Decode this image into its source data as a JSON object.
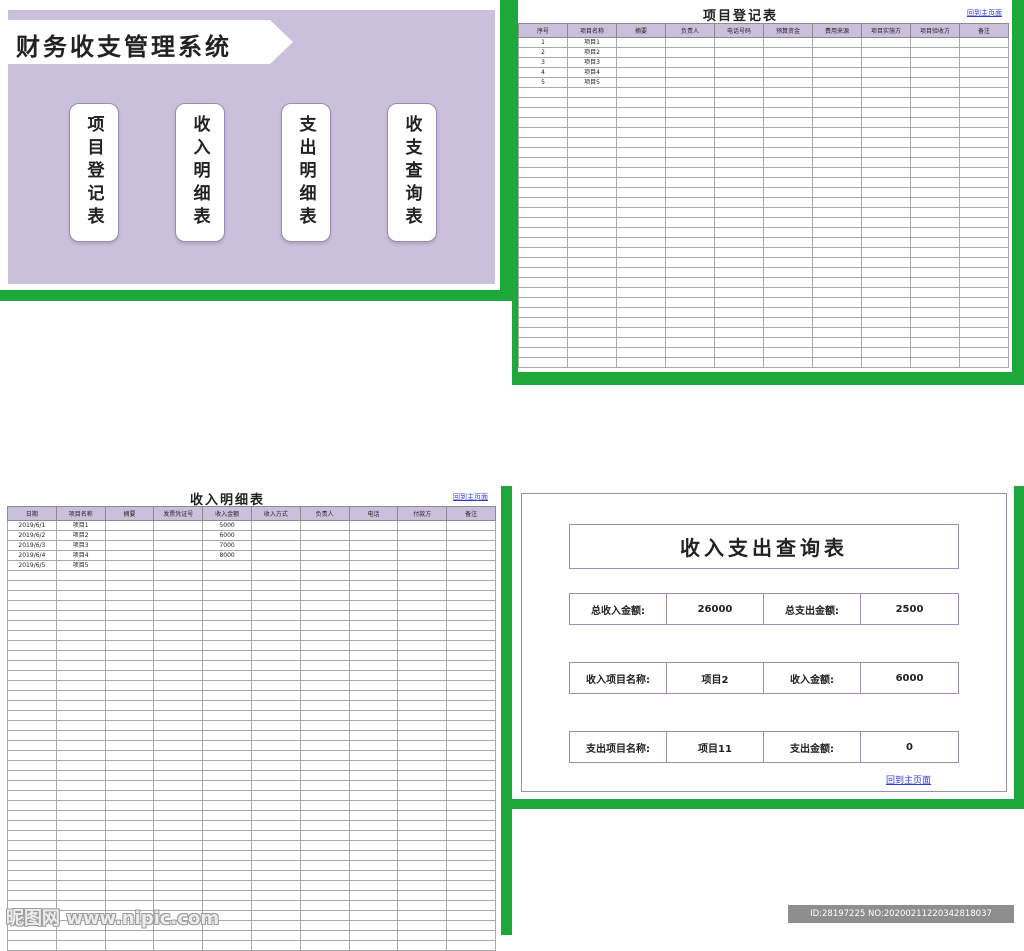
{
  "menu": {
    "title": "财务收支管理系统",
    "buttons": [
      "项目登记表",
      "收入明细表",
      "支出明细表",
      "收支查询表"
    ]
  },
  "project_sheet": {
    "title": "项目登记表",
    "back_link": "回到主页面",
    "headers": [
      "序号",
      "项目名称",
      "摘要",
      "负责人",
      "电话号码",
      "预算资金",
      "费用来源",
      "项目实施方",
      "项目验收方",
      "备注"
    ],
    "rows": [
      [
        "1",
        "项目1",
        "",
        "",
        "",
        "",
        "",
        "",
        "",
        ""
      ],
      [
        "2",
        "项目2",
        "",
        "",
        "",
        "",
        "",
        "",
        "",
        ""
      ],
      [
        "3",
        "项目3",
        "",
        "",
        "",
        "",
        "",
        "",
        "",
        ""
      ],
      [
        "4",
        "项目4",
        "",
        "",
        "",
        "",
        "",
        "",
        "",
        ""
      ],
      [
        "5",
        "项目5",
        "",
        "",
        "",
        "",
        "",
        "",
        "",
        ""
      ]
    ],
    "empty_rows": 28
  },
  "income_sheet": {
    "title": "收入明细表",
    "back_link": "回到主页面",
    "headers": [
      "日期",
      "项目名称",
      "摘要",
      "发票凭证号",
      "收入金额",
      "收入方式",
      "负责人",
      "电话",
      "付款方",
      "备注"
    ],
    "rows": [
      [
        "2019/6/1",
        "项目1",
        "",
        "",
        "5000",
        "",
        "",
        "",
        "",
        ""
      ],
      [
        "2019/6/2",
        "项目2",
        "",
        "",
        "6000",
        "",
        "",
        "",
        "",
        ""
      ],
      [
        "2019/6/3",
        "项目3",
        "",
        "",
        "7000",
        "",
        "",
        "",
        "",
        ""
      ],
      [
        "2019/6/4",
        "项目4",
        "",
        "",
        "8000",
        "",
        "",
        "",
        "",
        ""
      ],
      [
        "2019/6/5",
        "项目5",
        "",
        "",
        "",
        "",
        "",
        "",
        "",
        ""
      ]
    ],
    "empty_rows": 38
  },
  "query": {
    "title": "收入支出查询表",
    "total_income_label": "总收入金额:",
    "total_income": "26000",
    "total_expense_label": "总支出金额:",
    "total_expense": "2500",
    "income_item_label": "收入项目名称:",
    "income_item": "项目2",
    "income_amount_label": "收入金额:",
    "income_amount": "6000",
    "expense_item_label": "支出项目名称:",
    "expense_item": "项目11",
    "expense_amount_label": "支出金额:",
    "expense_amount": "0",
    "back_link": "回到主页面"
  },
  "watermark": {
    "site": "昵图网 www.nipic.com",
    "id": "ID:28197225 NO:20200211220342818037"
  },
  "colors": {
    "frame_green": "#1fa83a",
    "accent_purple": "#cbc0dc",
    "link_blue": "#2e3bd6"
  }
}
